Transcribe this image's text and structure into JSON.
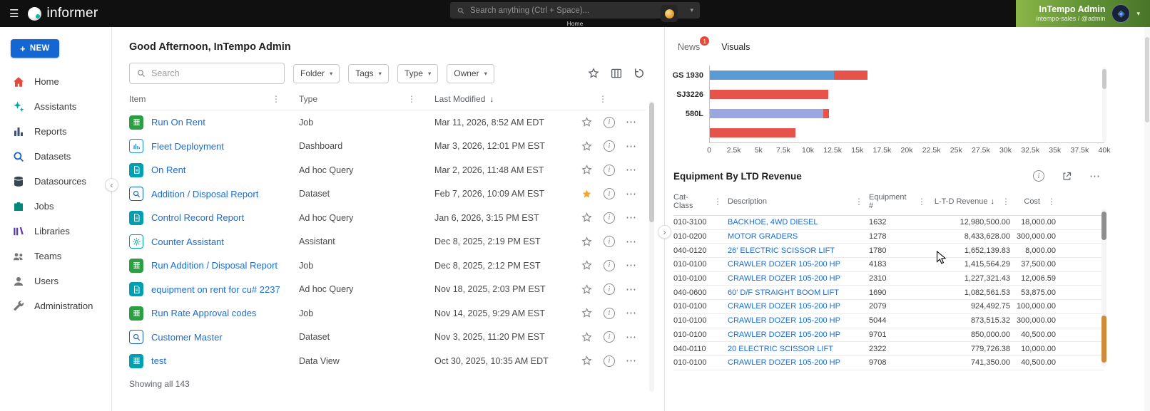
{
  "topbar": {
    "logo_text": "informer",
    "search_placeholder": "Search anything (Ctrl + Space)...",
    "search_caption": "Home",
    "user": {
      "name": "InTempo Admin",
      "subtitle": "intempo-sales / @admin"
    }
  },
  "sidebar": {
    "new_button_label": "NEW",
    "items": [
      {
        "id": "home",
        "label": "Home",
        "color": "#e5493a",
        "active": true
      },
      {
        "id": "assistants",
        "label": "Assistants",
        "color": "#00a3a3",
        "active": false
      },
      {
        "id": "reports",
        "label": "Reports",
        "color": "#3d4f73",
        "active": false
      },
      {
        "id": "datasets",
        "label": "Datasets",
        "color": "#1565c0",
        "active": false
      },
      {
        "id": "datasources",
        "label": "Datasources",
        "color": "#37474f",
        "active": false
      },
      {
        "id": "jobs",
        "label": "Jobs",
        "color": "#00897b",
        "active": false
      },
      {
        "id": "libraries",
        "label": "Libraries",
        "color": "#5e35b1",
        "active": false
      },
      {
        "id": "teams",
        "label": "Teams",
        "color": "#757575",
        "active": false
      },
      {
        "id": "users",
        "label": "Users",
        "color": "#757575",
        "active": false
      },
      {
        "id": "administration",
        "label": "Administration",
        "color": "#757575",
        "active": false
      }
    ]
  },
  "main": {
    "greeting": "Good Afternoon, InTempo Admin",
    "search_placeholder": "Search",
    "filters": [
      {
        "label": "Folder"
      },
      {
        "label": "Tags"
      },
      {
        "label": "Type"
      },
      {
        "label": "Owner"
      }
    ],
    "columns": [
      "Item",
      "Type",
      "Last Modified"
    ],
    "rows": [
      {
        "name": "Run On Rent",
        "type": "Job",
        "modified": "Mar 11, 2026, 8:52 AM EDT",
        "icon": "job",
        "icon_color": "#2e9e44",
        "starred": false
      },
      {
        "name": "Fleet Deployment",
        "type": "Dashboard",
        "modified": "Mar 3, 2026, 12:01 PM EST",
        "icon": "dashboard",
        "icon_color": "#1e88e5",
        "starred": false
      },
      {
        "name": "On Rent",
        "type": "Ad hoc Query",
        "modified": "Mar 2, 2026, 11:48 AM EST",
        "icon": "query",
        "icon_color": "#00a0b0",
        "starred": false
      },
      {
        "name": "Addition / Disposal Report",
        "type": "Dataset",
        "modified": "Feb 7, 2026, 10:09 AM EST",
        "icon": "dataset",
        "icon_color": "#1565c0",
        "starred": true
      },
      {
        "name": "Control Record Report",
        "type": "Ad hoc Query",
        "modified": "Jan 6, 2026, 3:15 PM EST",
        "icon": "query",
        "icon_color": "#00a0b0",
        "starred": false
      },
      {
        "name": "Counter Assistant",
        "type": "Assistant",
        "modified": "Dec 8, 2025, 2:19 PM EST",
        "icon": "assistant",
        "icon_color": "#00a3a3",
        "starred": false
      },
      {
        "name": "Run Addition / Disposal Report",
        "type": "Job",
        "modified": "Dec 8, 2025, 2:12 PM EST",
        "icon": "job",
        "icon_color": "#2e9e44",
        "starred": false
      },
      {
        "name": "equipment on rent for cu# 2237",
        "type": "Ad hoc Query",
        "modified": "Nov 18, 2025, 2:03 PM EST",
        "icon": "query",
        "icon_color": "#00a0b0",
        "starred": false
      },
      {
        "name": "Run Rate Approval codes",
        "type": "Job",
        "modified": "Nov 14, 2025, 9:29 AM EST",
        "icon": "job",
        "icon_color": "#2e9e44",
        "starred": false
      },
      {
        "name": "Customer Master",
        "type": "Dataset",
        "modified": "Nov 3, 2025, 11:20 PM EST",
        "icon": "dataset",
        "icon_color": "#1565c0",
        "starred": false
      },
      {
        "name": "test",
        "type": "Data View",
        "modified": "Oct 30, 2025, 10:35 AM EDT",
        "icon": "dataview",
        "icon_color": "#00a0b0",
        "starred": false
      }
    ],
    "footer": "Showing all 143"
  },
  "chart_data": {
    "type": "bar",
    "orientation": "horizontal",
    "xlim": [
      0,
      40000
    ],
    "xticks": [
      "0",
      "2.5k",
      "5k",
      "7.5k",
      "10k",
      "12.5k",
      "15k",
      "17.5k",
      "20k",
      "22.5k",
      "25k",
      "27.5k",
      "30k",
      "32.5k",
      "35k",
      "37.5k",
      "40k"
    ],
    "grid": false,
    "legend": "none",
    "bars": [
      {
        "label": "GS 1930",
        "back_value": 16000,
        "back_color": "#e5534a",
        "front_value": 12600,
        "front_color": "#5b9bd5"
      },
      {
        "label": "SJ3226",
        "back_value": 12000,
        "back_color": "#e5534a",
        "front_value": 0,
        "front_color": "#5b9bd5"
      },
      {
        "label": "580L",
        "back_value": 12100,
        "back_color": "#e5534a",
        "front_value": 11500,
        "front_color": "#9aa7e0"
      },
      {
        "label": "",
        "back_value": 8700,
        "back_color": "#e5534a",
        "front_value": 0,
        "front_color": "#5b9bd5"
      }
    ]
  },
  "right_panel": {
    "tabs": [
      {
        "label": "News",
        "badge": "1",
        "active": false
      },
      {
        "label": "Visuals",
        "badge": "",
        "active": true
      }
    ],
    "equipment": {
      "title": "Equipment By LTD Revenue",
      "columns": [
        "Cat-Class",
        "Description",
        "Equipment #",
        "L-T-D Revenue",
        "Cost"
      ],
      "rows": [
        [
          "010-3100",
          "BACKHOE, 4WD DIESEL",
          "1632",
          "12,980,500.00",
          "18,000.00"
        ],
        [
          "010-0200",
          "MOTOR GRADERS",
          "1278",
          "8,433,628.00",
          "300,000.00"
        ],
        [
          "040-0120",
          "26' ELECTRIC SCISSOR LIFT",
          "1780",
          "1,652,139.83",
          "8,000.00"
        ],
        [
          "010-0100",
          "CRAWLER DOZER 105-200 HP",
          "4183",
          "1,415,564.29",
          "37,500.00"
        ],
        [
          "010-0100",
          "CRAWLER DOZER 105-200 HP",
          "2310",
          "1,227,321.43",
          "12,006.59"
        ],
        [
          "040-0600",
          "60' D/F STRAIGHT BOOM LIFT",
          "1690",
          "1,082,561.53",
          "53,875.00"
        ],
        [
          "010-0100",
          "CRAWLER DOZER 105-200 HP",
          "2079",
          "924,492.75",
          "100,000.00"
        ],
        [
          "010-0100",
          "CRAWLER DOZER 105-200 HP",
          "5044",
          "873,515.32",
          "300,000.00"
        ],
        [
          "010-0100",
          "CRAWLER DOZER 105-200 HP",
          "9701",
          "850,000.00",
          "40,500.00"
        ],
        [
          "040-0110",
          "20 ELECTRIC SCISSOR LIFT",
          "2322",
          "779,726.38",
          "10,000.00"
        ],
        [
          "010-0100",
          "CRAWLER DOZER 105-200 HP",
          "9708",
          "741,350.00",
          "40,500.00"
        ]
      ]
    }
  }
}
